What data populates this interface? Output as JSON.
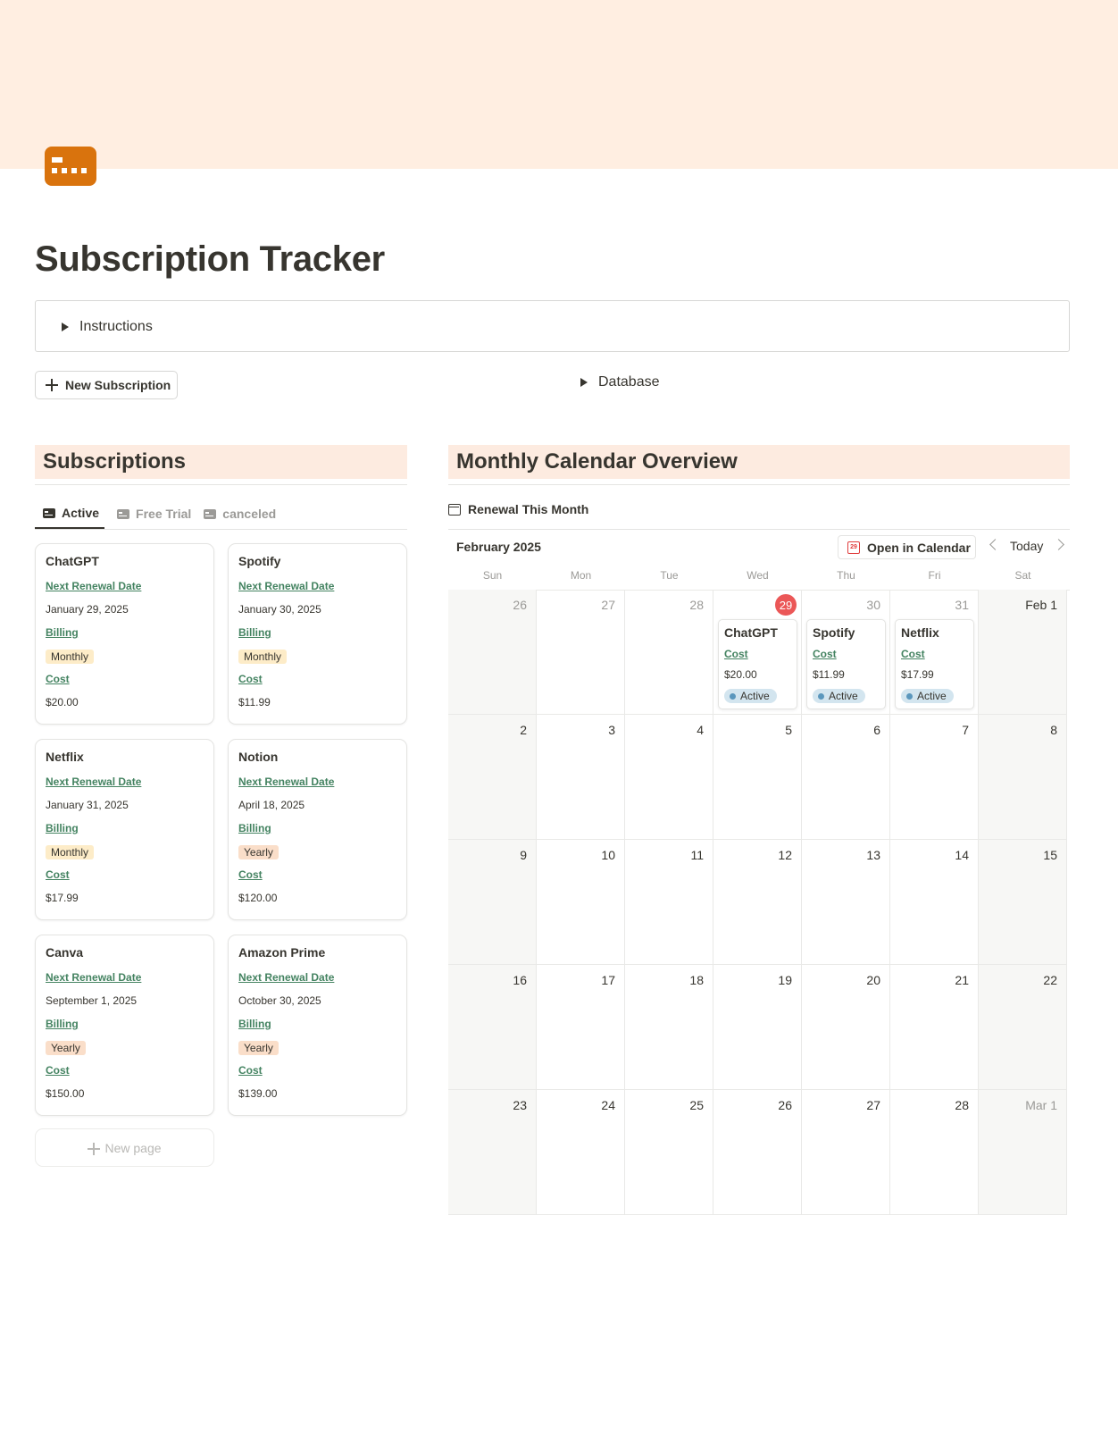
{
  "page": {
    "icon": "credit-card-icon",
    "title": "Subscription Tracker"
  },
  "toggles": {
    "instructions": "Instructions",
    "database": "Database"
  },
  "actions": {
    "new_subscription": "New Subscription"
  },
  "subscriptions": {
    "heading": "Subscriptions",
    "tabs": [
      {
        "label": "Active",
        "icon": "card-icon",
        "active": true
      },
      {
        "label": "Free Trial",
        "icon": "card-icon",
        "active": false
      },
      {
        "label": "canceled",
        "icon": "card-icon",
        "active": false
      }
    ],
    "field_labels": {
      "renewal": "Next Renewal Date",
      "billing": "Billing",
      "cost": "Cost"
    },
    "cards": [
      {
        "name": "ChatGPT",
        "renewal": "January 29, 2025",
        "billing": "Monthly",
        "cost": "$20.00"
      },
      {
        "name": "Spotify",
        "renewal": "January 30, 2025",
        "billing": "Monthly",
        "cost": "$11.99"
      },
      {
        "name": "Netflix",
        "renewal": "January 31, 2025",
        "billing": "Monthly",
        "cost": "$17.99"
      },
      {
        "name": "Notion",
        "renewal": "April 18, 2025",
        "billing": "Yearly",
        "cost": "$120.00"
      },
      {
        "name": "Canva",
        "renewal": "September 1, 2025",
        "billing": "Yearly",
        "cost": "$150.00"
      },
      {
        "name": "Amazon Prime",
        "renewal": "October 30, 2025",
        "billing": "Yearly",
        "cost": "$139.00"
      }
    ],
    "new_page": "New page"
  },
  "calendar": {
    "heading": "Monthly Calendar Overview",
    "view_tab": "Renewal This Month",
    "month": "February 2025",
    "open_in_calendar": "Open in Calendar",
    "open_icon_text": "29",
    "today": "Today",
    "weekdays": [
      "Sun",
      "Mon",
      "Tue",
      "Wed",
      "Thu",
      "Fri",
      "Sat"
    ],
    "weeks": [
      [
        "26",
        "27",
        "28",
        "29",
        "30",
        "31",
        "Feb 1"
      ],
      [
        "2",
        "3",
        "4",
        "5",
        "6",
        "7",
        "8"
      ],
      [
        "9",
        "10",
        "11",
        "12",
        "13",
        "14",
        "15"
      ],
      [
        "16",
        "17",
        "18",
        "19",
        "20",
        "21",
        "22"
      ],
      [
        "23",
        "24",
        "25",
        "26",
        "27",
        "28",
        "Mar 1"
      ]
    ],
    "today_cell": "29",
    "event_field_label": "Cost",
    "events": [
      {
        "name": "ChatGPT",
        "cost": "$20.00",
        "status": "Active",
        "week": 0,
        "day": 3
      },
      {
        "name": "Spotify",
        "cost": "$11.99",
        "status": "Active",
        "week": 0,
        "day": 4
      },
      {
        "name": "Netflix",
        "cost": "$17.99",
        "status": "Active",
        "week": 0,
        "day": 5
      }
    ]
  },
  "colors": {
    "cover": "#ffeee1",
    "icon": "#d9730d",
    "section_heading_bg": "#fdebe0",
    "property_label": "#448361",
    "monthly_pill": "#fdecc8",
    "yearly_pill": "#fadec9",
    "today_badge": "#eb5757",
    "status_pill": "#d3e5ef"
  }
}
